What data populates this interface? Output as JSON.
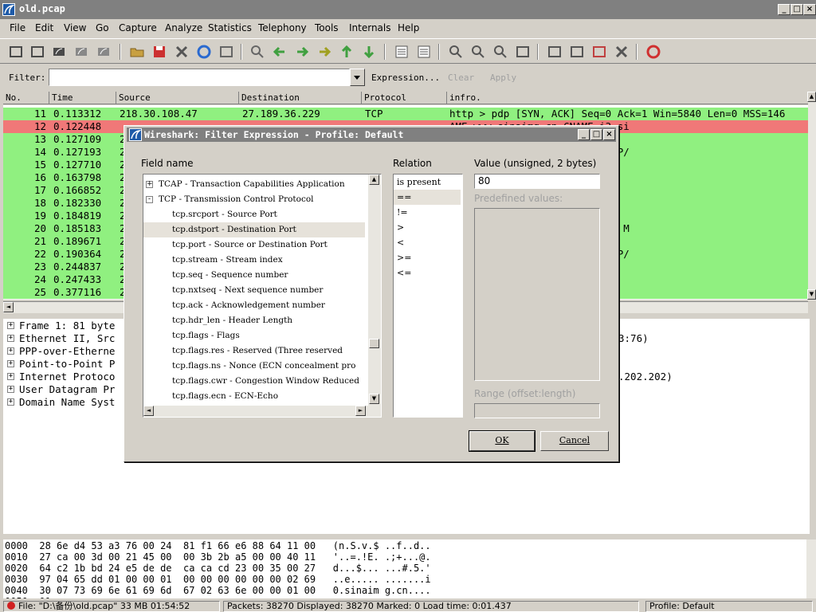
{
  "window": {
    "title": "old.pcap"
  },
  "menu": [
    "File",
    "Edit",
    "View",
    "Go",
    "Capture",
    "Analyze",
    "Statistics",
    "Telephony",
    "Tools",
    "Internals",
    "Help"
  ],
  "filter": {
    "label": "Filter:",
    "value": "",
    "expression": "Expression...",
    "clear": "Clear",
    "apply": "Apply"
  },
  "columns": [
    "No.",
    "Time",
    "Source",
    "Destination",
    "Protocol",
    "infro."
  ],
  "packets": [
    {
      "no": "11",
      "time": "0.113312",
      "src": "218.30.108.47",
      "dst": "27.189.36.229",
      "proto": "TCP",
      "info": "http > pdp [SYN, ACK] Seq=0 Ack=1 Win=5840 Len=0 MSS=146",
      "color": "green"
    },
    {
      "no": "12",
      "time": "0.122448",
      "src": "",
      "dst": "",
      "proto": "",
      "info": "AME www.sinaimg.cn CNAME i3.si",
      "color": "red"
    },
    {
      "no": "13",
      "time": "0.127109",
      "src": "2",
      "dst": "",
      "proto": "",
      "info": "1 Win=65535 Len=0",
      "color": "green"
    },
    {
      "no": "14",
      "time": "0.127193",
      "src": "2",
      "dst": "",
      "proto": "",
      "info": "t090213img/shanghai3.gif HTTP/",
      "color": "green"
    },
    {
      "no": "15",
      "time": "0.127710",
      "src": "2",
      "dst": "",
      "proto": "",
      "info": "Win=65535 Len=0 MSS=1440 WS",
      "color": "green"
    },
    {
      "no": "16",
      "time": "0.163798",
      "src": "2",
      "dst": "",
      "proto": "",
      "info": "Ack=364 Win=6912 Len=0",
      "color": "green"
    },
    {
      "no": "17",
      "time": "0.166852",
      "src": "2",
      "dst": "",
      "proto": "",
      "info": "",
      "color": "green"
    },
    {
      "no": "18",
      "time": "0.182330",
      "src": "2",
      "dst": "",
      "proto": "",
      "info": "=364 Win=6912 Len=0",
      "color": "green"
    },
    {
      "no": "19",
      "time": "0.184819",
      "src": "2",
      "dst": "",
      "proto": "",
      "info": "",
      "color": "green"
    },
    {
      "no": "20",
      "time": "0.185183",
      "src": "2",
      "dst": "",
      "proto": "",
      "info": "] Seq=0 Ack=1 Win=5840 Len=0 M",
      "color": "green"
    },
    {
      "no": "21",
      "time": "0.189671",
      "src": "2",
      "dst": "",
      "proto": "",
      "info": "1 Ack=1 Win=65535 Len=0",
      "color": "green"
    },
    {
      "no": "22",
      "time": "0.190364",
      "src": "2",
      "dst": "",
      "proto": "",
      "info": "t090213img/shanghai5.gif HTTP/",
      "color": "green"
    },
    {
      "no": "23",
      "time": "0.244837",
      "src": "2",
      "dst": "",
      "proto": "",
      "info": "1 Ack=364 Win=6912 Len=0",
      "color": "green"
    },
    {
      "no": "24",
      "time": "0.247433",
      "src": "2",
      "dst": "",
      "proto": "",
      "info": "",
      "color": "green"
    },
    {
      "no": "25",
      "time": "0.377116",
      "src": "2",
      "dst": "",
      "proto": "",
      "info": "=364 Ack=642 Win=64894 Len=0",
      "color": "green"
    }
  ],
  "details": [
    {
      "text": "Frame 1: 81 byte",
      "right": ""
    },
    {
      "text": "Ethernet II, Src",
      "right": "3:76)"
    },
    {
      "text": "PPP-over-Etherne",
      "right": ""
    },
    {
      "text": "Point-to-Point P",
      "right": ""
    },
    {
      "text": "Internet Protoco",
      "right": ".202.202)"
    },
    {
      "text": "User Datagram Pr",
      "right": ""
    },
    {
      "text": "Domain Name Syst",
      "right": ""
    }
  ],
  "hex": [
    "0000  28 6e d4 53 a3 76 00 24  81 f1 66 e6 88 64 11 00   (n.S.v.$ ..f..d..",
    "0010  27 ca 00 3d 00 21 45 00  00 3b 2b a5 00 00 40 11   '..=.!E. .;+...@.",
    "0020  64 c2 1b bd 24 e5 de de  ca ca cd 23 00 35 00 27   d...$... ...#.5.'",
    "0030  97 04 65 dd 01 00 00 01  00 00 00 00 00 00 02 69   ..e..... .......i",
    "0040  30 07 73 69 6e 61 69 6d  67 02 63 6e 00 00 01 00   0.sinaim g.cn....",
    "0050  01"
  ],
  "status": {
    "file": "File: \"D:\\备份\\old.pcap\" 33 MB 01:54:52",
    "packets": "Packets: 38270 Displayed: 38270 Marked: 0 Load time: 0:01.437",
    "profile": "Profile: Default"
  },
  "dialog": {
    "title": "Wireshark: Filter Expression - Profile: Default",
    "field_label": "Field name",
    "relation_label": "Relation",
    "value_label": "Value (unsigned, 2 bytes)",
    "value": "80",
    "predefined_label": "Predefined values:",
    "range_label": "Range (offset:length)",
    "ok": "OK",
    "cancel": "Cancel",
    "fields": [
      {
        "text": "TCAP - Transaction Capabilities Application",
        "indent": 0,
        "expander": "+"
      },
      {
        "text": "TCP - Transmission Control Protocol",
        "indent": 0,
        "expander": "-"
      },
      {
        "text": "tcp.srcport - Source Port",
        "indent": 1
      },
      {
        "text": "tcp.dstport - Destination Port",
        "indent": 1,
        "selected": true
      },
      {
        "text": "tcp.port - Source or Destination Port",
        "indent": 1
      },
      {
        "text": "tcp.stream - Stream index",
        "indent": 1
      },
      {
        "text": "tcp.seq - Sequence number",
        "indent": 1
      },
      {
        "text": "tcp.nxtseq - Next sequence number",
        "indent": 1
      },
      {
        "text": "tcp.ack - Acknowledgement number",
        "indent": 1
      },
      {
        "text": "tcp.hdr_len - Header Length",
        "indent": 1
      },
      {
        "text": "tcp.flags - Flags",
        "indent": 1
      },
      {
        "text": "tcp.flags.res - Reserved (Three reserved",
        "indent": 1
      },
      {
        "text": "tcp.flags.ns - Nonce (ECN concealment pro",
        "indent": 1
      },
      {
        "text": "tcp.flags.cwr - Congestion Window Reduced",
        "indent": 1
      },
      {
        "text": "tcp.flags.ecn - ECN-Echo",
        "indent": 1
      }
    ],
    "relations": [
      "is present",
      "==",
      "!=",
      ">",
      "<",
      ">=",
      "<="
    ],
    "selected_relation": 1
  },
  "colors": {
    "green": "#90f080",
    "red": "#f07878",
    "highlight": "#e6e2da"
  }
}
